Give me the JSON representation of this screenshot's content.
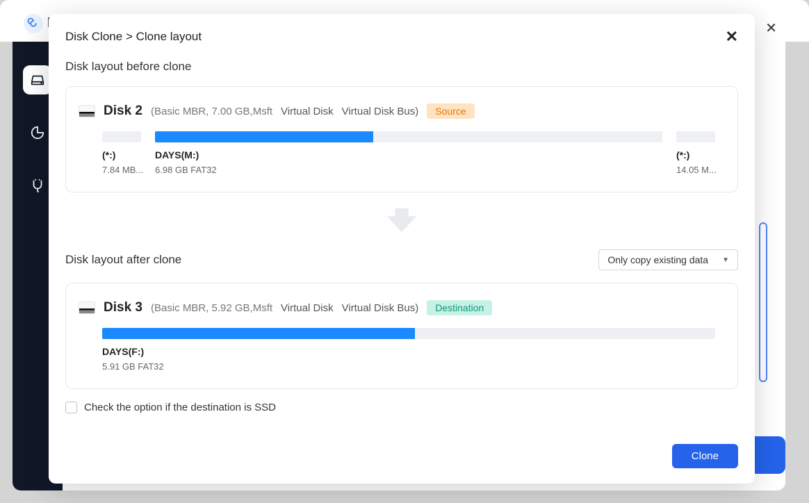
{
  "breadcrumb": {
    "parent": "Disk Clone",
    "sep": ">",
    "current": "Clone layout"
  },
  "sections": {
    "before_title": "Disk layout before clone",
    "after_title": "Disk layout after clone"
  },
  "copy_mode": {
    "selected": "Only copy existing data"
  },
  "source_disk": {
    "name": "Disk 2",
    "spec": "(Basic MBR, 7.00 GB,Msft",
    "col2": "Virtual Disk",
    "col3": "Virtual Disk Bus)",
    "badge": "Source",
    "parts": [
      {
        "label": "(*:)",
        "sub": "7.84 MB..."
      },
      {
        "label": "DAYS(M:)",
        "sub": "6.98 GB FAT32"
      },
      {
        "label": "(*:)",
        "sub": "14.05 M..."
      }
    ]
  },
  "dest_disk": {
    "name": "Disk 3",
    "spec": "(Basic MBR, 5.92 GB,Msft",
    "col2": "Virtual Disk",
    "col3": "Virtual Disk Bus)",
    "badge": "Destination",
    "parts": [
      {
        "label": "DAYS(F:)",
        "sub": "5.91 GB FAT32"
      }
    ]
  },
  "ssd_check": {
    "label": "Check the option if the destination is SSD"
  },
  "buttons": {
    "clone": "Clone"
  }
}
